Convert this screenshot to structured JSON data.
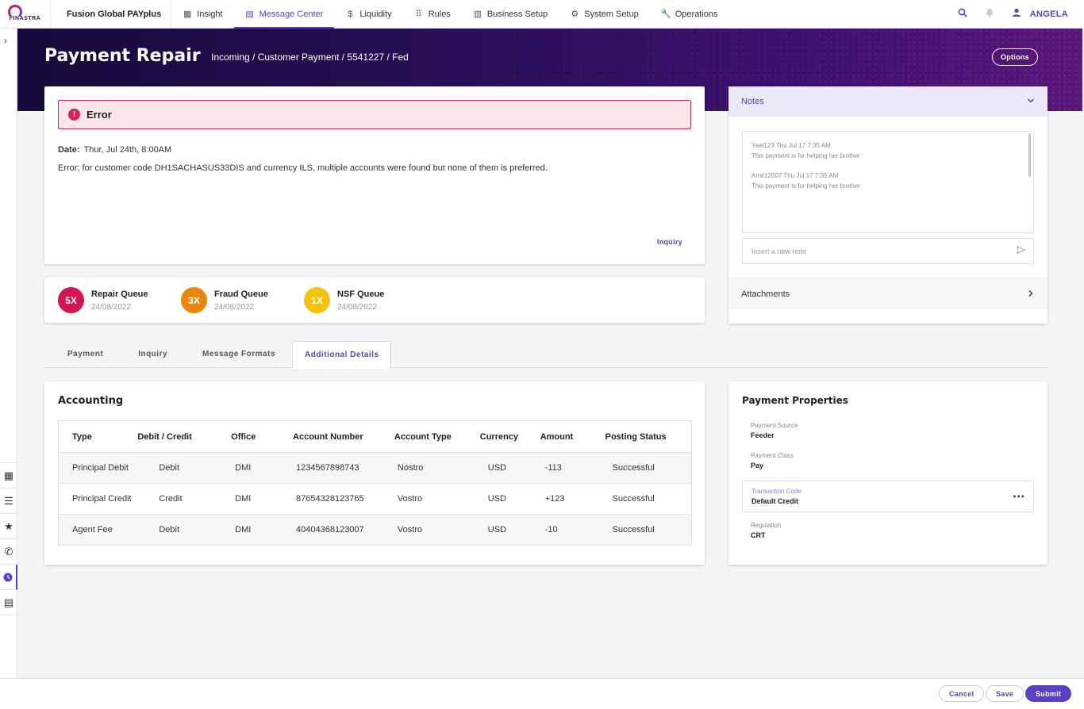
{
  "nav": {
    "brand": "FINASTRA",
    "app_name": "Fusion Global PAYplus",
    "items": [
      {
        "label": "Insight",
        "icon": "dashboard-icon"
      },
      {
        "label": "Message Center",
        "icon": "document-icon"
      },
      {
        "label": "Liquidity",
        "icon": "money-icon"
      },
      {
        "label": "Rules",
        "icon": "grid-icon"
      },
      {
        "label": "Business Setup",
        "icon": "briefcase-icon"
      },
      {
        "label": "System Setup",
        "icon": "gear-icon"
      },
      {
        "label": "Operations",
        "icon": "wrench-icon"
      }
    ],
    "active": "Message Center",
    "user": "ANGELA"
  },
  "header": {
    "title": "Payment Repair",
    "breadcrumb": "Incoming / Customer Payment / 5541227 / Fed",
    "options_label": "Options"
  },
  "error": {
    "title": "Error",
    "date_label": "Date:",
    "date_value": "Thur, Jul 24th, 8:00AM",
    "message": "Error; for customer code DH1SACHASUS33DIS and currency ILS, multiple accounts were found but none of them is preferred.",
    "inquiry_label": "Inquiry"
  },
  "queues": [
    {
      "count": "5X",
      "name": "Repair Queue",
      "date": "24/08/2022",
      "color": "#d0174f"
    },
    {
      "count": "3X",
      "name": "Fraud Queue",
      "date": "24/08/2022",
      "color": "#e8870c"
    },
    {
      "count": "1X",
      "name": "NSF Queue",
      "date": "24/08/2022",
      "color": "#f4c20d"
    }
  ],
  "tabs": [
    "Payment",
    "Inquiry",
    "Message Formats",
    "Additional Details"
  ],
  "active_tab": "Additional Details",
  "accounting": {
    "title": "Accounting",
    "columns": [
      "Type",
      "Debit / Credit",
      "Office",
      "Account Number",
      "Account Type",
      "Currency",
      "Amount",
      "Posting Status"
    ],
    "rows": [
      [
        "Principal Debit",
        "Debit",
        "DMI",
        "1234567898743",
        "Nostro",
        "USD",
        "-113",
        "Successful"
      ],
      [
        "Principal Credit",
        "Credit",
        "DMI",
        "87654328123765",
        "Vostro",
        "USD",
        "+123",
        "Successful"
      ],
      [
        "Agent Fee",
        "Debit",
        "DMI",
        "40404368123007",
        "Vostro",
        "USD",
        "-10",
        "Successful"
      ]
    ]
  },
  "notes": {
    "title": "Notes",
    "entries": [
      {
        "header": "Yael123 Thu Jul 17 7:35 AM",
        "text": "This payment is for helping her brother"
      },
      {
        "header": "Amit12007 Thu Jul 17 7:35 AM",
        "text": "This payment is for helping her brother"
      }
    ],
    "input_placeholder": "Insert a new note",
    "attachments_label": "Attachments"
  },
  "properties": {
    "title": "Payment Properties",
    "items": [
      {
        "label": "Payment Source",
        "value": "Feeder"
      },
      {
        "label": "Payment Class",
        "value": "Pay"
      },
      {
        "label": "Transaction Code",
        "value": "Default Credit"
      },
      {
        "label": "Regulation",
        "value": "CRT"
      }
    ]
  },
  "footer": {
    "cancel_label": "Cancel",
    "save_label": "Save",
    "submit_label": "Submit"
  },
  "colors": {
    "accent": "#5b3fc4",
    "error": "#d6235b"
  }
}
